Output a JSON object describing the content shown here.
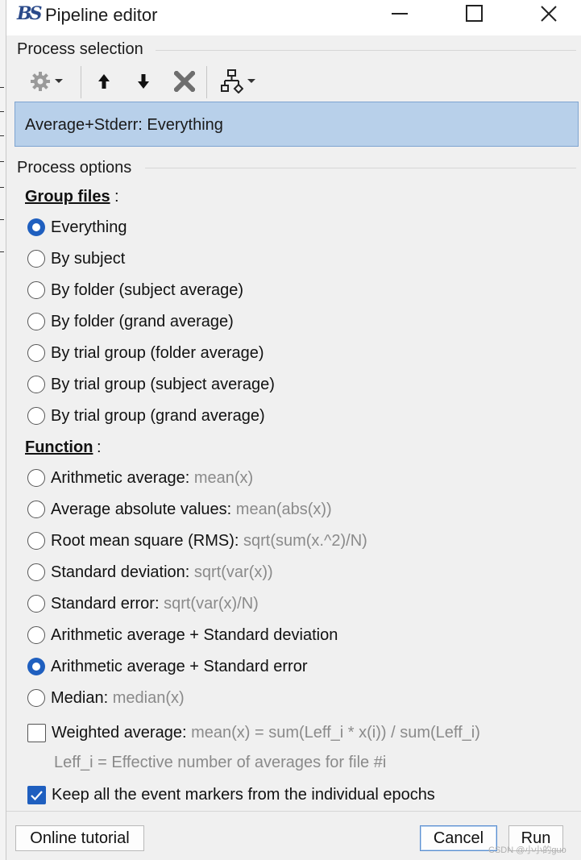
{
  "window": {
    "title": "Pipeline editor"
  },
  "process_selection": {
    "label": "Process selection",
    "toolbar": {
      "buttons": [
        "gear-icon",
        "chevron-down-icon",
        "arrow-up-icon",
        "arrow-down-icon",
        "delete-icon",
        "pipeline-tree-icon",
        "chevron-down-icon"
      ]
    },
    "items": [
      "Average+Stderr: Everything"
    ]
  },
  "process_options": {
    "label": "Process options",
    "group_files": {
      "heading": "Group files",
      "colon": ":",
      "selected": "Everything",
      "options": [
        "Everything",
        "By subject",
        "By folder (subject average)",
        "By folder (grand average)",
        "By trial group (folder average)",
        "By trial group (subject average)",
        "By trial group (grand average)"
      ]
    },
    "function": {
      "heading": "Function",
      "colon": ":",
      "selected": "Arithmetic average + Standard error",
      "options": [
        {
          "label": "Arithmetic average: ",
          "formula": "mean(x)"
        },
        {
          "label": "Average absolute values: ",
          "formula": "mean(abs(x))"
        },
        {
          "label": "Root mean square (RMS): ",
          "formula": "sqrt(sum(x.^2)/N)"
        },
        {
          "label": "Standard deviation: ",
          "formula": "sqrt(var(x))"
        },
        {
          "label": "Standard error: ",
          "formula": "sqrt(var(x)/N)"
        },
        {
          "label": "Arithmetic average + Standard deviation",
          "formula": ""
        },
        {
          "label": "Arithmetic average + Standard error",
          "formula": ""
        },
        {
          "label": "Median: ",
          "formula": "median(x)"
        }
      ]
    },
    "weighted": {
      "label": "Weighted average: ",
      "formula": "mean(x) = sum(Leff_i * x(i)) / sum(Leff_i)",
      "checked": false,
      "note": "Leff_i = Effective number of averages for file #i"
    },
    "keep_events": {
      "label": "Keep all the event markers from the individual epochs",
      "checked": true
    }
  },
  "buttons": {
    "tutorial": "Online tutorial",
    "cancel": "Cancel",
    "run": "Run"
  },
  "watermark": "CSDN @小小的guo",
  "colors": {
    "accent": "#1f5fbf",
    "selection": "#b8d0ea",
    "formula": "#8a8a8a"
  }
}
